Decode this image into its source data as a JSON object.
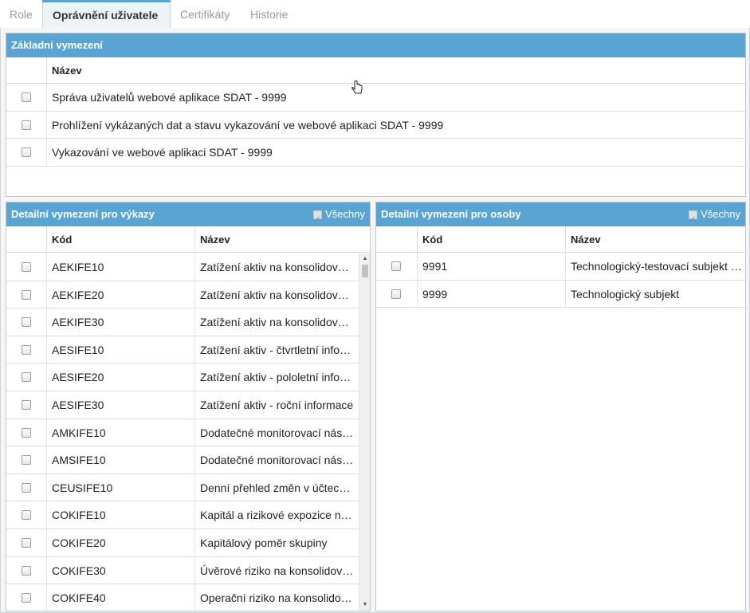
{
  "tabs": [
    {
      "label": "Role",
      "active": false
    },
    {
      "label": "Oprávnění uživatele",
      "active": true
    },
    {
      "label": "Certifikáty",
      "active": false
    },
    {
      "label": "Historie",
      "active": false
    }
  ],
  "basic": {
    "title": "Základní vymezení",
    "header_name": "Název",
    "rows": [
      {
        "name": "Správa uživatelů webové aplikace SDAT - 9999"
      },
      {
        "name": "Prohlížení vykázaných dat a stavu vykazování ve webové aplikaci SDAT - 9999"
      },
      {
        "name": "Vykazování ve webové aplikaci SDAT - 9999"
      }
    ]
  },
  "reports": {
    "title": "Detailní vymezení pro výkazy",
    "all_label": "Všechny",
    "header_code": "Kód",
    "header_name": "Název",
    "rows": [
      {
        "code": "AEKIFE10",
        "name": "Zatížení aktiv na konsolidovan…"
      },
      {
        "code": "AEKIFE20",
        "name": "Zatížení aktiv na konsolidovan…"
      },
      {
        "code": "AEKIFE30",
        "name": "Zatížení aktiv na konsolidovan…"
      },
      {
        "code": "AESIFE10",
        "name": "Zatížení aktiv - čtvrtletní infor…"
      },
      {
        "code": "AESIFE20",
        "name": "Zatížení aktiv - pololetní infor…"
      },
      {
        "code": "AESIFE30",
        "name": "Zatížení aktiv - roční informace"
      },
      {
        "code": "AMKIFE10",
        "name": "Dodatečné monitorovací nástr…"
      },
      {
        "code": "AMSIFE10",
        "name": "Dodatečné monitorovací nástr…"
      },
      {
        "code": "CEUSIFE10",
        "name": "Denní přehled změn v účtech …"
      },
      {
        "code": "COKIFE10",
        "name": "Kapitál a rizikové expozice na …"
      },
      {
        "code": "COKIFE20",
        "name": "Kapitálový poměr skupiny"
      },
      {
        "code": "COKIFE30",
        "name": "Úvěrové riziko na konsolidova…"
      },
      {
        "code": "COKIFE40",
        "name": "Operační riziko na konsolidov…"
      }
    ]
  },
  "persons": {
    "title": "Detailní vymezení pro osoby",
    "all_label": "Všechny",
    "header_code": "Kód",
    "header_name": "Název",
    "rows": [
      {
        "code": "9991",
        "name": "Technologický-testovací subjekt S…"
      },
      {
        "code": "9999",
        "name": "Technologický subjekt"
      }
    ]
  },
  "colors": {
    "header_blue": "#5aa4d4",
    "tab_active_bg": "#eef3f8"
  }
}
